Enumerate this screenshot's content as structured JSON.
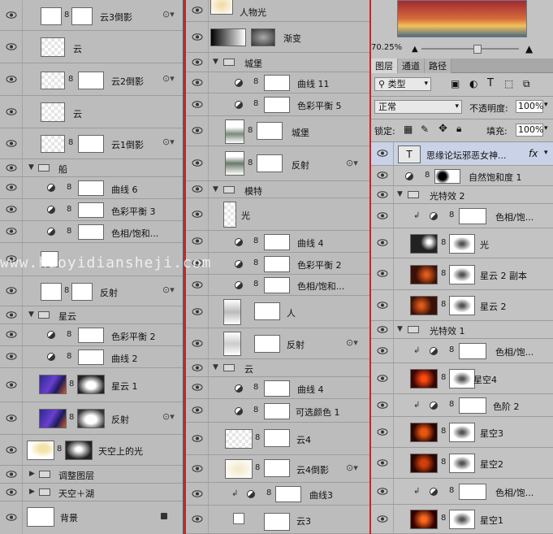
{
  "watermark": "www.haoyidiansheji.com",
  "panel1": {
    "rows": [
      {
        "label": "云3倒影",
        "kind": "smart"
      },
      {
        "label": "云",
        "kind": "layer"
      },
      {
        "label": "云2倒影",
        "kind": "smart"
      },
      {
        "label": "云",
        "kind": "layer"
      },
      {
        "label": "云1倒影",
        "kind": "smart"
      },
      {
        "label": "船",
        "kind": "group"
      },
      {
        "label": "曲线 6",
        "kind": "adj"
      },
      {
        "label": "色彩平衡 3",
        "kind": "adj"
      },
      {
        "label": "色相/饱和...",
        "kind": "adj"
      },
      {
        "label": "",
        "kind": "plain"
      },
      {
        "label": "反射",
        "kind": "smart"
      },
      {
        "label": "星云",
        "kind": "group"
      },
      {
        "label": "色彩平衡 2",
        "kind": "adj"
      },
      {
        "label": "曲线 2",
        "kind": "adj"
      },
      {
        "label": "星云 1",
        "kind": "img"
      },
      {
        "label": "反射",
        "kind": "smart"
      },
      {
        "label": "天空上的光",
        "kind": "img"
      },
      {
        "label": "调整图层",
        "kind": "group"
      },
      {
        "label": "天空＋湖",
        "kind": "group"
      },
      {
        "label": "背景",
        "kind": "bg"
      }
    ]
  },
  "panel2": {
    "rows": [
      {
        "label": "人物光"
      },
      {
        "label": "渐变"
      },
      {
        "label": "城堡"
      },
      {
        "label": "曲线 11"
      },
      {
        "label": "色彩平衡 5"
      },
      {
        "label": "城堡"
      },
      {
        "label": "反射"
      },
      {
        "label": "模特"
      },
      {
        "label": "光"
      },
      {
        "label": "曲线 4"
      },
      {
        "label": "色彩平衡 2"
      },
      {
        "label": "色相/饱和..."
      },
      {
        "label": "人"
      },
      {
        "label": "反射"
      },
      {
        "label": "云"
      },
      {
        "label": "曲线 4"
      },
      {
        "label": "可选颜色 1"
      },
      {
        "label": "云4"
      },
      {
        "label": "云4倒影"
      },
      {
        "label": "曲线3"
      },
      {
        "label": "云3"
      }
    ]
  },
  "panel3": {
    "zoom": "70.25%",
    "tabs": [
      "图层",
      "通道",
      "路径"
    ],
    "kind_filter": "类型",
    "blend_mode": "正常",
    "opacity_label": "不透明度:",
    "opacity_value": "100%",
    "lock_label": "锁定:",
    "fill_label": "填充:",
    "fill_value": "100%",
    "text_layer": "思缘论坛邪恶女神...",
    "fx": "fx",
    "rows": [
      {
        "label": "自然饱和度 1"
      },
      {
        "label": "光特效 2"
      },
      {
        "label": "色相/饱..."
      },
      {
        "label": "光"
      },
      {
        "label": "星云 2 副本"
      },
      {
        "label": "星云 2"
      },
      {
        "label": "光特效 1"
      },
      {
        "label": "色相/饱..."
      },
      {
        "label": "星空4"
      },
      {
        "label": "色阶 2"
      },
      {
        "label": "星空3"
      },
      {
        "label": "星空2"
      },
      {
        "label": "色相/饱..."
      },
      {
        "label": "星空1"
      }
    ]
  }
}
